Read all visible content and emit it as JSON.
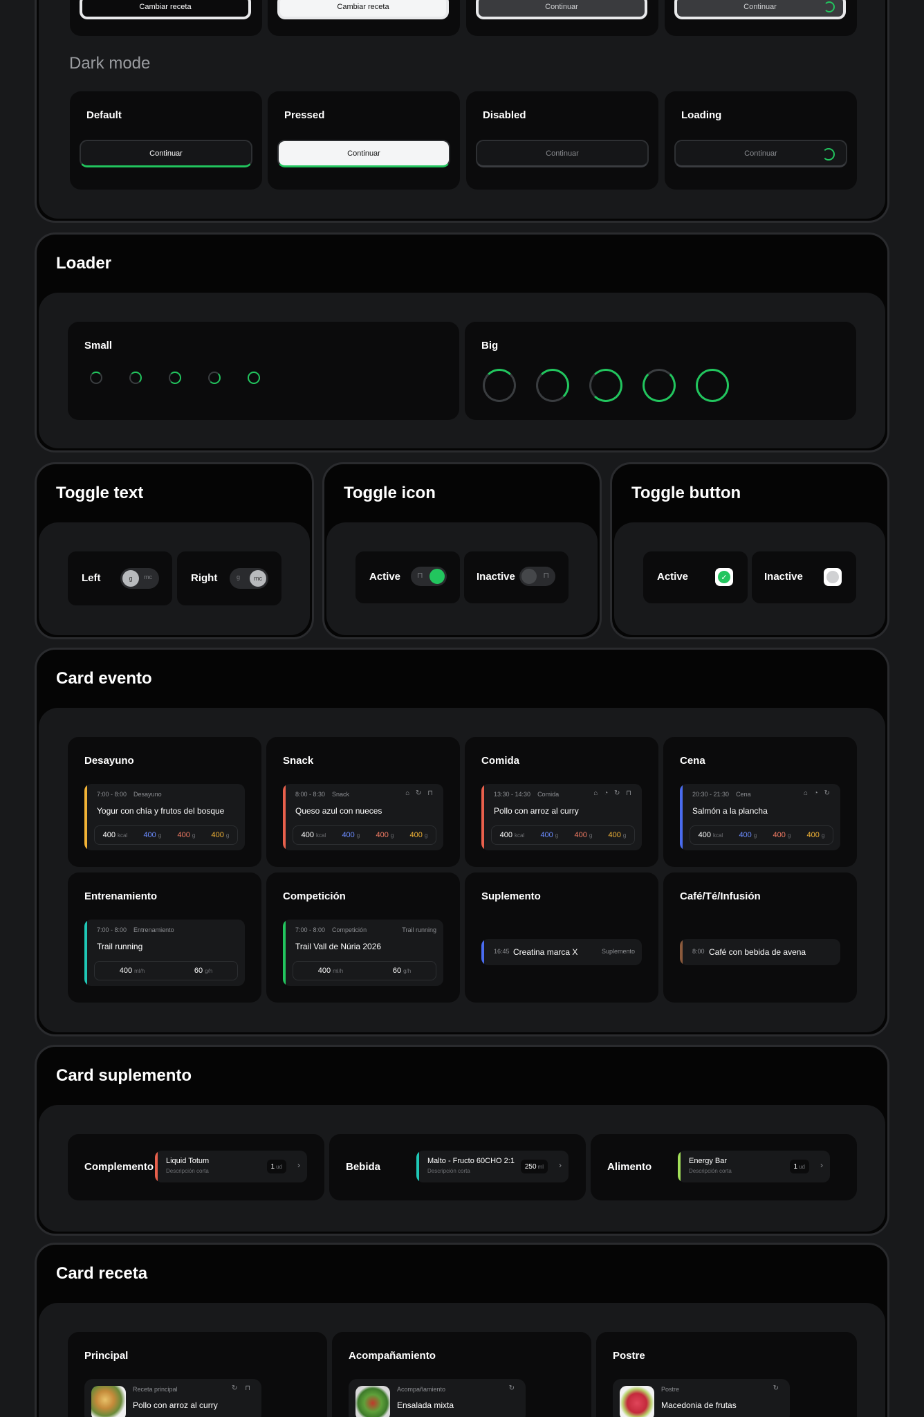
{
  "button_section": {
    "top_row_labels": [
      "Cambiar receta",
      "Cambiar receta",
      "Continuar",
      "Continuar"
    ],
    "dark_mode_title": "Dark mode",
    "states": [
      {
        "label": "Default",
        "button": "Continuar"
      },
      {
        "label": "Pressed",
        "button": "Continuar"
      },
      {
        "label": "Disabled",
        "button": "Continuar"
      },
      {
        "label": "Loading",
        "button": "Continuar"
      }
    ]
  },
  "loader": {
    "title": "Loader",
    "small_label": "Small",
    "big_label": "Big"
  },
  "toggle_text": {
    "title": "Toggle text",
    "left": {
      "label": "Left",
      "opt1": "g",
      "opt2": "mc"
    },
    "right": {
      "label": "Right",
      "opt1": "g",
      "opt2": "mc"
    }
  },
  "toggle_icon": {
    "title": "Toggle icon",
    "active_label": "Active",
    "inactive_label": "Inactive",
    "lock_icon": "lock-icon"
  },
  "toggle_button": {
    "title": "Toggle button",
    "active_label": "Active",
    "inactive_label": "Inactive",
    "check_icon": "check-icon"
  },
  "card_evento": {
    "title": "Card evento",
    "meals": [
      {
        "label": "Desayuno",
        "time": "7:00 - 8:00",
        "type": "Desayuno",
        "name": "Yogur con chía y frutos del bosque",
        "color": "#f2b336",
        "icons": "",
        "kcal": "400",
        "p": "400",
        "c": "400",
        "f": "400"
      },
      {
        "label": "Snack",
        "time": "8:00 - 8:30",
        "type": "Snack",
        "name": "Queso azul con nueces",
        "color": "#e8604c",
        "icons": "⌂ ↻ ⊓",
        "kcal": "400",
        "p": "400",
        "c": "400",
        "f": "400"
      },
      {
        "label": "Comida",
        "time": "13:30 - 14:30",
        "type": "Comida",
        "name": "Pollo con arroz al curry",
        "color": "#e8604c",
        "icons": "⌂ ◔ ↻ ⊓",
        "kcal": "400",
        "p": "400",
        "c": "400",
        "f": "400"
      },
      {
        "label": "Cena",
        "time": "20:30 - 21:30",
        "type": "Cena",
        "name": "Salmón a la plancha",
        "color": "#4a6cf0",
        "icons": "⌂ ◔  ↻",
        "kcal": "400",
        "p": "400",
        "c": "400",
        "f": "400"
      }
    ],
    "macro_units": {
      "kcal": "kcal",
      "g": "g"
    },
    "trainings": [
      {
        "label": "Entrenamiento",
        "time": "7:00 - 8:00",
        "type": "Entrenamiento",
        "tag": "",
        "name": "Trail running",
        "color": "#1fc7b6",
        "v1": "400",
        "u1": "ml/h",
        "v2": "60",
        "u2": "g/h"
      },
      {
        "label": "Competición",
        "time": "7:00 - 8:00",
        "type": "Competición",
        "tag": "Trail running",
        "name": "Trail Vall de Núria 2026",
        "color": "#22c55e",
        "v1": "400",
        "u1": "ml/h",
        "v2": "60",
        "u2": "g/h"
      }
    ],
    "suplemento": {
      "label": "Suplemento",
      "time": "16:45",
      "name": "Creatina marca X",
      "tag": "Suplemento",
      "color": "#4a6cf0"
    },
    "cafe": {
      "label": "Café/Té/Infusión",
      "time": "8:00",
      "name": "Café con bebida de avena",
      "color": "#8b5a3c"
    }
  },
  "card_suplemento": {
    "title": "Card suplemento",
    "items": [
      {
        "label": "Complemento",
        "name": "Liquid Totum",
        "desc": "Descripción corta",
        "qty": "1",
        "unit": "ud",
        "color": "#e8604c"
      },
      {
        "label": "Bebida",
        "name": "Malto - Fructo 60CHO 2:1",
        "desc": "Descripción corta",
        "qty": "250",
        "unit": "ml",
        "color": "#1fc7b6"
      },
      {
        "label": "Alimento",
        "name": "Energy Bar",
        "desc": "Descripción corta",
        "qty": "1",
        "unit": "ud",
        "color": "#a3e05a"
      }
    ]
  },
  "card_receta": {
    "title": "Card receta",
    "items": [
      {
        "label": "Principal",
        "tag": "Receta principal",
        "name": "Pollo con arroz al curry",
        "icons": "↻ ⊓"
      },
      {
        "label": "Acompañamiento",
        "tag": "Acompañamiento",
        "name": "Ensalada mixta",
        "icons": "↻"
      },
      {
        "label": "Postre",
        "tag": "Postre",
        "name": "Macedonia de frutas",
        "icons": "↻"
      }
    ]
  },
  "colors": {
    "accent": "#22c55e",
    "background": "#18191b",
    "card": "#0b0b0c"
  }
}
